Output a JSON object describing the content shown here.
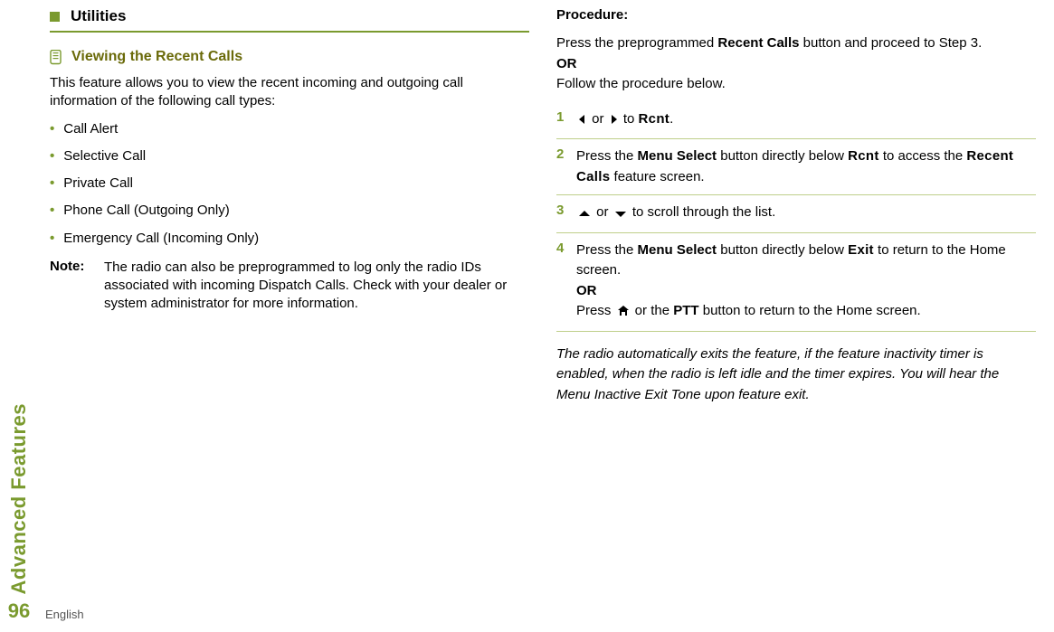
{
  "sidebar": {
    "label": "Advanced Features",
    "page_number": "96"
  },
  "footer": {
    "language": "English"
  },
  "left": {
    "section_title": "Utilities",
    "sub_title": "Viewing the Recent Calls",
    "intro": "This feature allows you to view the recent incoming and outgoing call information of the following call types:",
    "bullets": [
      "Call Alert",
      "Selective Call",
      "Private Call",
      "Phone Call (Outgoing Only)",
      "Emergency Call (Incoming Only)"
    ],
    "note_label": "Note:",
    "note_body": "The radio can also be preprogrammed to log only the radio IDs associated with incoming Dispatch Calls. Check with your dealer or system administrator for more information."
  },
  "right": {
    "procedure_label": "Procedure:",
    "intro_1a": "Press the preprogrammed ",
    "intro_1b": "Recent Calls",
    "intro_1c": " button and proceed to Step 3.",
    "or": "OR",
    "intro_2": "Follow the procedure below.",
    "steps": {
      "s1": {
        "num": "1",
        "a": " or ",
        "b": " to ",
        "rcnt": "Rcnt",
        "end": "."
      },
      "s2": {
        "num": "2",
        "a": "Press the ",
        "menu": "Menu Select",
        "b": " button directly below ",
        "rcnt": "Rcnt",
        "c": " to access the ",
        "feat": "Recent Calls",
        "d": " feature screen."
      },
      "s3": {
        "num": "3",
        "a": " or ",
        "b": " to scroll through the list."
      },
      "s4": {
        "num": "4",
        "a": "Press the ",
        "menu": "Menu Select",
        "b": " button directly below ",
        "exit": "Exit",
        "c": " to return to the Home screen.",
        "or": "OR",
        "d": "Press ",
        "e": " or the ",
        "ptt": "PTT",
        "f": " button to return to the Home screen."
      }
    },
    "footer_note": "The radio automatically exits the feature, if the feature inactivity timer is enabled, when the radio is left idle and the timer expires. You will hear the Menu Inactive Exit Tone upon feature exit."
  }
}
